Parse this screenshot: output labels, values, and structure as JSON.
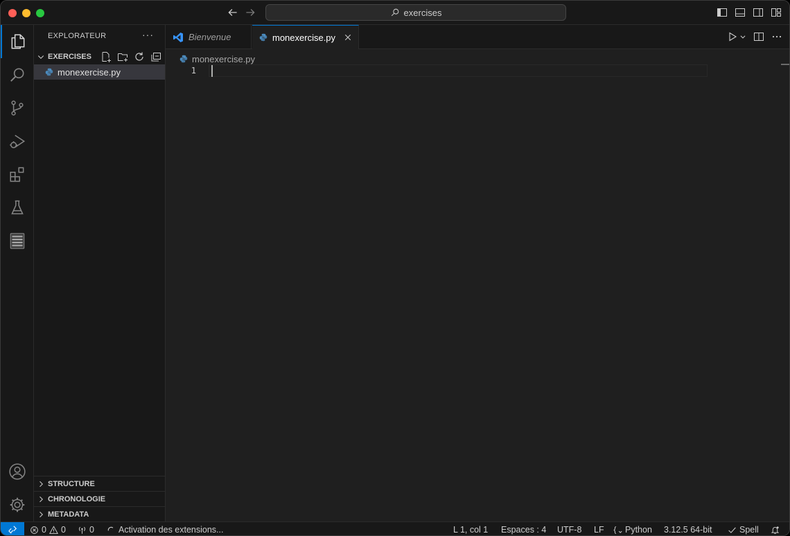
{
  "titlebar": {
    "search_text": "exercises"
  },
  "sidebar": {
    "title": "EXPLORATEUR",
    "more": "···",
    "folder_name": "EXERCISES",
    "files": [
      {
        "label": "monexercise.py"
      }
    ],
    "bottom_sections": [
      "STRUCTURE",
      "CHRONOLOGIE",
      "METADATA"
    ]
  },
  "tabs": [
    {
      "label": "Bienvenue",
      "active": false
    },
    {
      "label": "monexercise.py",
      "active": true
    }
  ],
  "editor": {
    "breadcrumb": "monexercise.py",
    "line_numbers": [
      "1"
    ]
  },
  "statusbar": {
    "errors": "0",
    "warnings": "0",
    "ports": "0",
    "activity": "Activation des extensions...",
    "position": "L 1, col 1",
    "indent": "Espaces : 4",
    "encoding": "UTF-8",
    "eol": "LF",
    "language": "Python",
    "interpreter": "3.12.5 64-bit",
    "spell": "Spell"
  },
  "colors": {
    "accent": "#0078d4",
    "python_icon": "#4b8bbe",
    "vscode_icon": "#3794ff"
  }
}
